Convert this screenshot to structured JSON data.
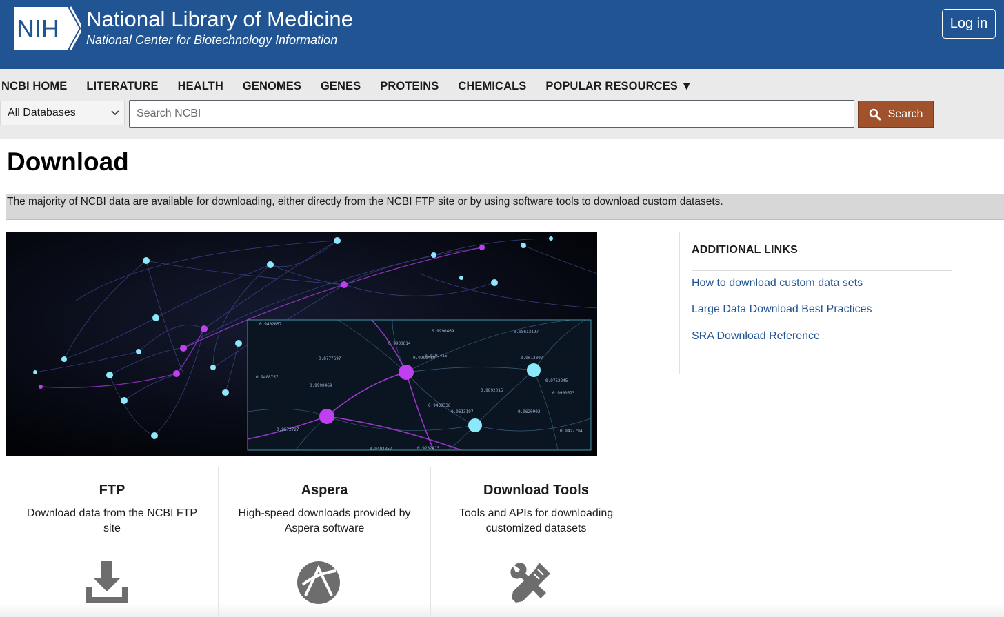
{
  "header": {
    "logo_text": "NIH",
    "title": "National Library of Medicine",
    "subtitle": "National Center for Biotechnology Information",
    "login_label": "Log in",
    "brand_color": "#205493"
  },
  "nav": {
    "items": [
      "NCBI HOME",
      "LITERATURE",
      "HEALTH",
      "GENOMES",
      "GENES",
      "PROTEINS",
      "CHEMICALS",
      "POPULAR RESOURCES ▼"
    ]
  },
  "search": {
    "database_selected": "All Databases",
    "placeholder": "Search NCBI",
    "button_label": "Search",
    "button_color": "#a0522d"
  },
  "page": {
    "title": "Download",
    "intro": "The majority of NCBI data are available for downloading, either directly from the NCBI FTP site or by using software tools to download custom datasets."
  },
  "additional_links": {
    "heading": "ADDITIONAL LINKS",
    "links": [
      "How to download custom data sets",
      "Large Data Download Best Practices",
      "SRA Download Reference"
    ]
  },
  "cards": [
    {
      "title": "FTP",
      "description": "Download data from the NCBI FTP site",
      "icon": "download-icon"
    },
    {
      "title": "Aspera",
      "description": "High-speed downloads provided by Aspera software",
      "icon": "aspera-icon"
    },
    {
      "title": "Download Tools",
      "description": "Tools and APIs for downloading customized datasets",
      "icon": "tools-icon"
    }
  ],
  "hero_image": {
    "icon": "network-graph-image",
    "labels": [
      "0.9402857",
      "0.98613197",
      "0.9612307",
      "0.9990469",
      "0.8777697",
      "0.9408757",
      "0.9990469",
      "0.9752245",
      "0.9900573",
      "0.9439336",
      "0.9427794",
      "0.9572727",
      "0.9402857",
      "0.9282415",
      "0.9990469",
      "0.9892015",
      "0.9620902",
      "0.9613197",
      "0.9900614",
      "0.9292415"
    ]
  }
}
